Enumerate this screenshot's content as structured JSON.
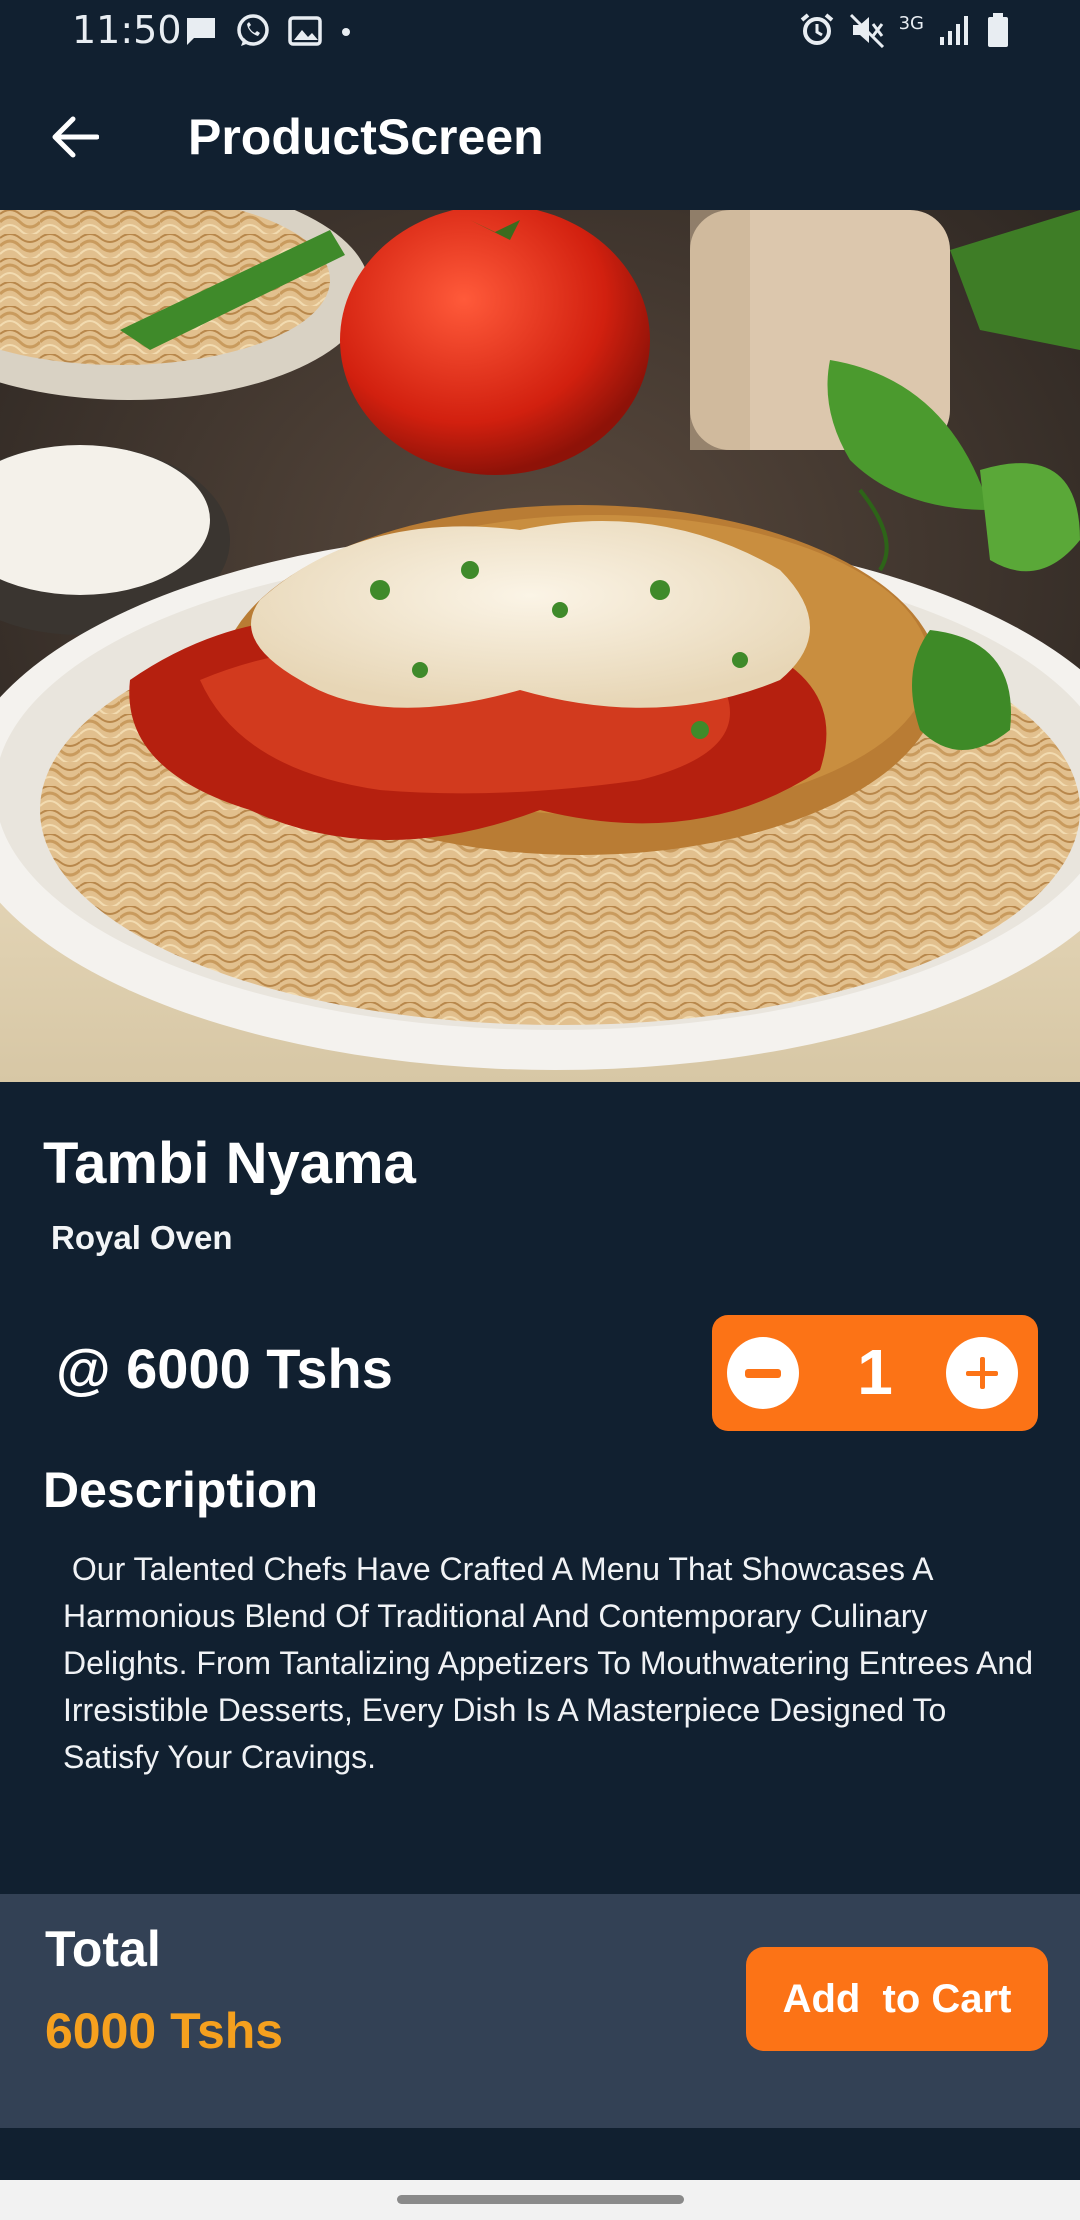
{
  "status_bar": {
    "time": "11:50",
    "left_icons": [
      "message-icon",
      "whatsapp-icon",
      "gallery-icon",
      "dot-icon"
    ],
    "right_icons": [
      "alarm-icon",
      "mute-icon",
      "network-3g-icon",
      "signal-icon",
      "battery-icon"
    ],
    "network_label": "3G"
  },
  "app_bar": {
    "title": "ProductScreen",
    "back_icon": "back-arrow-icon"
  },
  "product": {
    "name": "Tambi Nyama",
    "restaurant": "Royal Oven",
    "price": "@ 6000 Tshs",
    "quantity": "1",
    "description_heading": "Description",
    "description": " Our Talented Chefs Have Crafted A Menu That Showcases A Harmonious Blend Of Traditional And Contemporary Culinary Delights. From Tantalizing Appetizers To Mouthwatering Entrees And Irresistible Desserts, Every Dish Is A Masterpiece Designed To Satisfy Your Cravings."
  },
  "footer": {
    "total_label": "Total",
    "total_value": "6000 Tshs",
    "add_to_cart_label": "Add  to Cart"
  },
  "colors": {
    "background": "#112030",
    "accent": "#fc7316",
    "total_value": "#f5a01e",
    "panel": "#334155"
  }
}
